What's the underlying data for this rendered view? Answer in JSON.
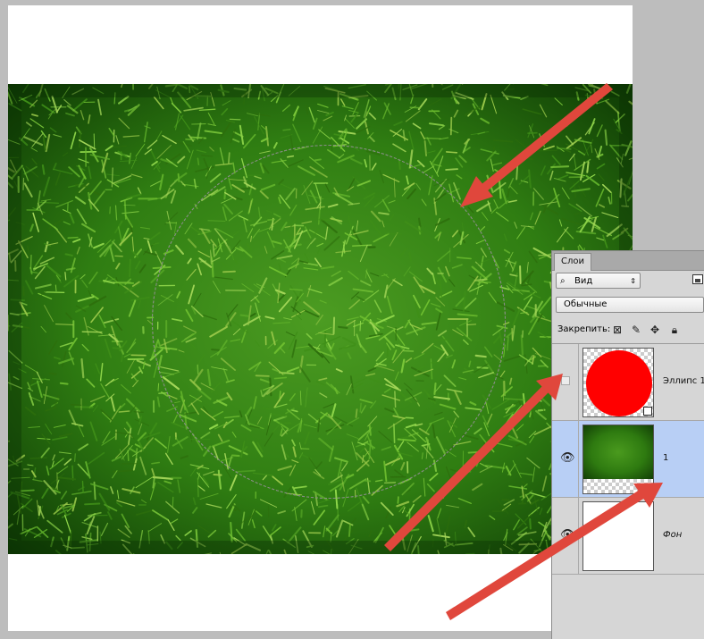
{
  "panel": {
    "tab_label": "Слои",
    "filter": {
      "icon": "search-icon",
      "label": "Вид"
    },
    "blend_mode": "Обычные",
    "lock_label": "Закрепить:",
    "lock_icons": [
      "lock-transparent-pixels-icon",
      "lock-image-pixels-icon",
      "lock-position-icon",
      "lock-all-icon"
    ],
    "layers": [
      {
        "name": "Эллипс 1",
        "visible": false,
        "selected": false,
        "thumbnail": "red-ellipse"
      },
      {
        "name": "1",
        "visible": true,
        "selected": true,
        "thumbnail": "grass-texture"
      },
      {
        "name": "Фон",
        "visible": true,
        "selected": false,
        "thumbnail": "white-background"
      }
    ]
  },
  "canvas": {
    "selection_shape": "ellipse",
    "image_subject": "grass texture"
  },
  "annotations": {
    "arrow_color": "#e0473c",
    "arrow_count": 3
  }
}
